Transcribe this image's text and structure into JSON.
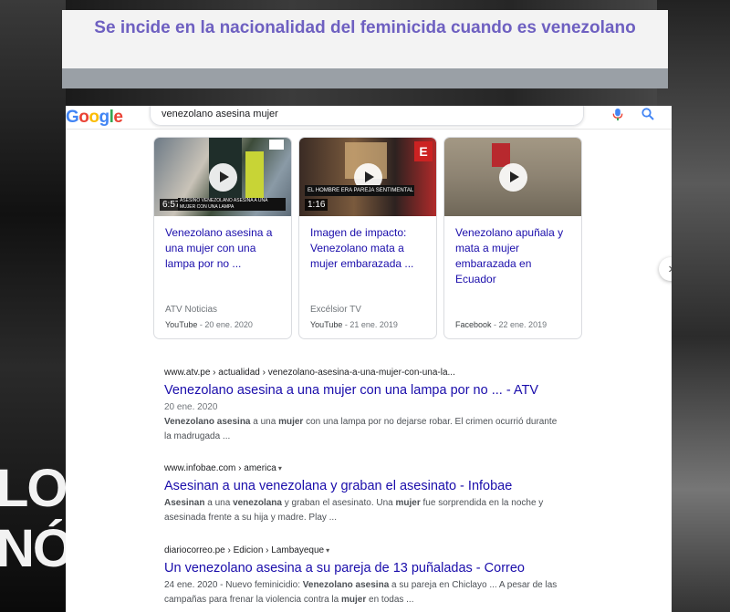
{
  "overlay": {
    "title": "Se incide en la nacionalidad del feminicida cuando es venezolano",
    "bg_word_1": "LO",
    "bg_word_2": "NÓ",
    "accent_color": "#6e60c1"
  },
  "google": {
    "logo_letters": [
      "G",
      "o",
      "o",
      "g",
      "l",
      "e"
    ],
    "logo_colors": [
      "#4285f4",
      "#ea4335",
      "#fbbc05",
      "#4285f4",
      "#34a853",
      "#ea4335"
    ],
    "search_query": "venezolano asesina mujer",
    "mic_icon": "microphone-icon",
    "search_icon": "magnifier-icon"
  },
  "videos": [
    {
      "duration": "6:57",
      "thumb_caption": "ASESINO VENEZOLANO ASESINA A UNA MUJER CON UNA LAMPA",
      "title": "Venezolano asesina a una mujer con una lampa por no ...",
      "source": "ATV Noticias",
      "platform": "YouTube",
      "date": "20 ene. 2020"
    },
    {
      "duration": "1:16",
      "thumb_caption": "EL HOMBRE ERA PAREJA SENTIMENTAL DE LA VÍCTIMA",
      "title": "Imagen de impacto: Venezolano mata a mujer embarazada ...",
      "source": "Excélsior TV",
      "platform": "YouTube",
      "date": "21 ene. 2019"
    },
    {
      "duration": "",
      "thumb_caption": "",
      "title": "Venezolano apuñala y mata a mujer embarazada en Ecuador",
      "source": "",
      "platform": "Facebook",
      "date": "22 ene. 2019"
    }
  ],
  "results": [
    {
      "cite": "www.atv.pe › actualidad › venezolano-asesina-a-una-mujer-con-una-la...",
      "has_caret": false,
      "title": "Venezolano asesina a una mujer con una lampa por no ... - ATV",
      "date": "20 ene. 2020",
      "snippet_html": "<b>Venezolano asesina</b> a una <b>mujer</b> con una lampa por no dejarse robar. El crimen ocurrió durante la madrugada ..."
    },
    {
      "cite": "www.infobae.com › america",
      "has_caret": true,
      "title": "Asesinan a una venezolana y graban el asesinato - Infobae",
      "date": "",
      "snippet_html": "<b>Asesinan</b> a una <b>venezolana</b> y graban el asesinato. Una <b>mujer</b> fue sorprendida en la noche y asesinada frente a su hija y madre. Play ..."
    },
    {
      "cite": "diariocorreo.pe › Edicion › Lambayeque",
      "has_caret": true,
      "title": "Un venezolano asesina a su pareja de 13 puñaladas - Correo",
      "date": "",
      "snippet_html": "24 ene. 2020 - Nuevo feminicidio: <b>Venezolano asesina</b> a su pareja en Chiclayo ... A pesar de las campañas para frenar la violencia contra la <b>mujer</b> en todas ..."
    }
  ],
  "ui": {
    "next_arrow": "›",
    "caret": "▾",
    "meta_sep": " - "
  }
}
